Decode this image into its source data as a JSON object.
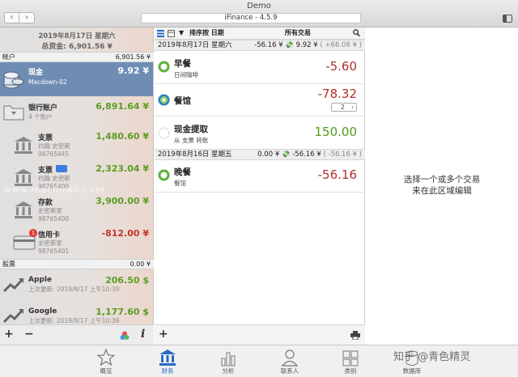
{
  "window": {
    "title": "Demo",
    "url": "iFinance - 4.5.9"
  },
  "nav": {
    "back": "‹",
    "forward": "›"
  },
  "left": {
    "date": "2019年8月17日 星期六",
    "total": "总资金: 6,901.56 ¥",
    "accounts_header": {
      "label": "帐户",
      "value": "6,901.56 ¥"
    },
    "accounts": [
      {
        "name": "现金",
        "sub": "Macdown-02",
        "value": "9.92 ¥"
      },
      {
        "name": "银行账户",
        "sub": "4 个账户",
        "value": "6,891.64 ¥"
      },
      {
        "name": "支票",
        "sub1": "约翰 史密斯",
        "sub2": "98765445",
        "value": "1,480.60 ¥"
      },
      {
        "name": "支票",
        "sub1": "约翰 史密斯",
        "sub2": "98765400",
        "value": "2,323.04 ¥"
      },
      {
        "name": "存款",
        "sub1": "史密斯家",
        "sub2": "98765400",
        "value": "3,900.00 ¥"
      },
      {
        "name": "信用卡",
        "sub1": "史密斯家",
        "sub2": "98765401",
        "value": "-812.00 ¥",
        "badge": "1"
      }
    ],
    "stocks_header": {
      "label": "股票",
      "value": "0.00 ¥"
    },
    "stocks": [
      {
        "name": "Apple",
        "sub": "上次更新: 2019/8/17 上午10:39",
        "value": "206.50 $"
      },
      {
        "name": "Google",
        "sub": "上次更新: 2019/8/17 上午10:39",
        "value": "1,177.60 $"
      }
    ],
    "footer": {
      "add": "+",
      "remove": "−",
      "info": "i"
    }
  },
  "middle": {
    "toolbar": {
      "sort": "排序按 日期",
      "filter": "所有交易",
      "search_icon": "search-icon"
    },
    "groups": [
      {
        "date": "2019年8月17日 星期六",
        "summary_a": "-56.16 ¥",
        "summary_b": "9.92 ¥",
        "summary_c": "( +66.08 ¥ )",
        "transactions": [
          {
            "name": "早餐",
            "sub": "日间咖啡",
            "amount": "-5.60",
            "kind": "neg"
          },
          {
            "name": "餐馆",
            "sub": "",
            "amount": "-78.32",
            "kind": "neg",
            "split": "2"
          },
          {
            "name": "现金提取",
            "sub": "从 支票 转账",
            "amount": "150.00",
            "kind": "pos"
          }
        ]
      },
      {
        "date": "2019年8月16日 星期五",
        "summary_a": "0.00 ¥",
        "summary_b": "-56.16 ¥",
        "summary_c": "( -56.16 ¥ )",
        "transactions": [
          {
            "name": "晚餐",
            "sub": "餐馆",
            "amount": "-56.16",
            "kind": "neg"
          }
        ]
      }
    ],
    "footer": {
      "add": "+"
    }
  },
  "right": {
    "line1": "选择一个或多个交易",
    "line2": "来在此区域编辑"
  },
  "tabs": [
    {
      "label": "概览",
      "icon": "star-icon"
    },
    {
      "label": "财务",
      "icon": "bank-icon",
      "active": true
    },
    {
      "label": "分析",
      "icon": "bar-chart-icon"
    },
    {
      "label": "联系人",
      "icon": "person-icon"
    },
    {
      "label": "类别",
      "icon": "category-icon"
    },
    {
      "label": "数据库",
      "icon": "database-icon"
    }
  ],
  "watermarks": {
    "macdown": "www.macdown.com",
    "zhihu": "知乎 @青色精灵"
  },
  "colors": {
    "positive": "#5a9d22",
    "negative": "#c0362c",
    "selected": "#6f8db4",
    "active_tab": "#2b68c5"
  }
}
